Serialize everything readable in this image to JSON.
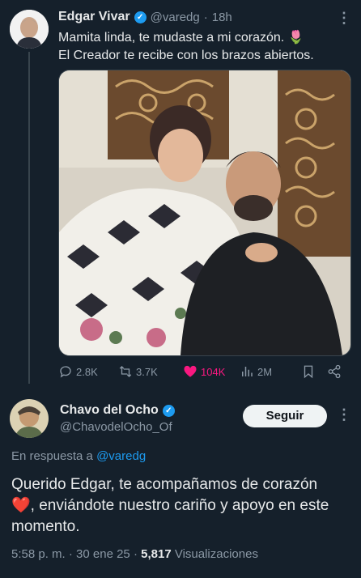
{
  "tweet1": {
    "display_name": "Edgar Vivar",
    "handle": "@varedg",
    "time": "18h",
    "line1": "Mamita linda, te mudaste a mi corazón.",
    "line1_emoji": "🌷",
    "line2": "El Creador te recibe con los brazos abiertos.",
    "replies": "2.8K",
    "retweets": "3.7K",
    "likes": "104K",
    "views": "2M"
  },
  "tweet2": {
    "display_name": "Chavo del Ocho",
    "handle": "@ChavodelOcho_Of",
    "follow_label": "Seguir",
    "reply_prefix": "En respuesta a",
    "reply_to": "@varedg",
    "body_before": "Querido Edgar, te acompañamos de corazón",
    "body_emoji": "❤️",
    "body_after": ", enviándote nuestro cariño y apoyo en este momento.",
    "time": "5:58 p. m.",
    "date": "30 ene 25",
    "views_count": "5,817",
    "views_label": "Visualizaciones"
  },
  "colors": {
    "background": "#15202b",
    "accent": "#1d9bf0",
    "like": "#f91880",
    "muted": "#8b98a5"
  },
  "icons": [
    "more-icon",
    "reply-icon",
    "retweet-icon",
    "heart-icon",
    "views-icon",
    "bookmark-icon",
    "share-icon",
    "verified-icon"
  ]
}
